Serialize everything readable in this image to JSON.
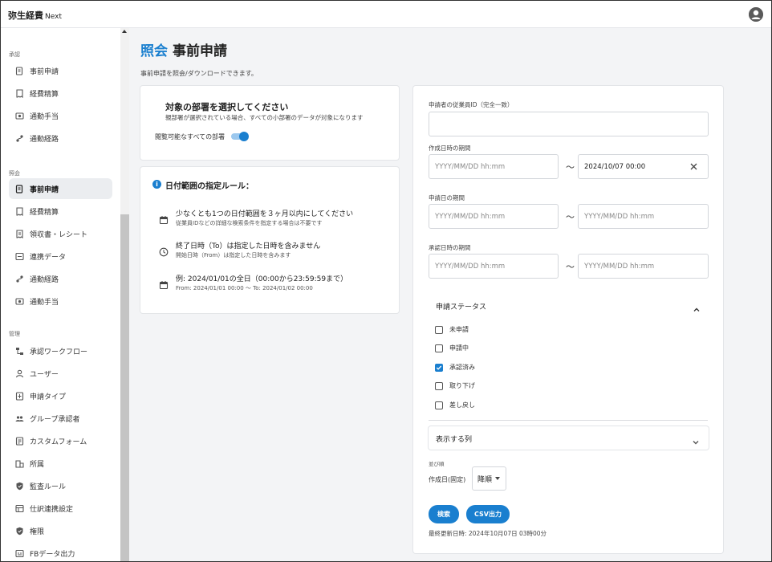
{
  "app": {
    "logo": "弥生経費",
    "logo_suffix": "Next"
  },
  "sidebar": {
    "sections": [
      {
        "label": "承認"
      },
      {
        "label": "照会"
      },
      {
        "label": "管理"
      }
    ],
    "approval_items": [
      {
        "label": "事前申請",
        "icon": "document-icon"
      },
      {
        "label": "経費精算",
        "icon": "receipt-icon"
      },
      {
        "label": "通勤手当",
        "icon": "commute-allowance-icon"
      },
      {
        "label": "通勤経路",
        "icon": "route-icon"
      }
    ],
    "inquiry_items": [
      {
        "label": "事前申請",
        "icon": "document-icon",
        "active": true
      },
      {
        "label": "経費精算",
        "icon": "receipt-icon"
      },
      {
        "label": "領収書・レシート",
        "icon": "receipt-icon"
      },
      {
        "label": "連携データ",
        "icon": "link-data-icon"
      },
      {
        "label": "通勤経路",
        "icon": "route-icon"
      },
      {
        "label": "通勤手当",
        "icon": "commute-allowance-icon"
      }
    ],
    "admin_items": [
      {
        "label": "承認ワークフロー",
        "icon": "workflow-icon"
      },
      {
        "label": "ユーザー",
        "icon": "user-icon"
      },
      {
        "label": "申請タイプ",
        "icon": "form-type-icon"
      },
      {
        "label": "グループ承認者",
        "icon": "group-icon"
      },
      {
        "label": "カスタムフォーム",
        "icon": "custom-form-icon"
      },
      {
        "label": "所属",
        "icon": "building-icon"
      },
      {
        "label": "監査ルール",
        "icon": "shield-icon"
      },
      {
        "label": "仕訳連携設定",
        "icon": "journal-link-icon"
      },
      {
        "label": "権限",
        "icon": "shield-icon"
      },
      {
        "label": "FBデータ出力",
        "icon": "fb-export-icon"
      }
    ]
  },
  "page": {
    "crumb": "照会",
    "title": "事前申請",
    "description": "事前申請を照会/ダウンロードできます。"
  },
  "department": {
    "title": "対象の部署を選択してください",
    "subtitle": "親部署が選択されている場合、すべての小部署のデータが対象になります",
    "toggle_label": "閲覧可能なすべての部署",
    "toggle_on": true
  },
  "rules": {
    "title": "日付範囲の指定ルール：",
    "items": [
      {
        "icon": "calendar-icon",
        "main": "少なくとも1つの日付範囲を３ヶ月以内にしてください",
        "sub": "従業員IDなどの詳細な検索条件を指定する場合は不要です"
      },
      {
        "icon": "clock-icon",
        "main": "終了日時（To）は指定した日時を含みません",
        "sub": "開始日時（From）は指定した日時を含みます"
      },
      {
        "icon": "calendar-icon",
        "main": "例: 2024/01/01の全日（00:00から23:59:59まで）",
        "sub": "From: 2024/01/01 00:00 〜 To: 2024/01/02 00:00"
      }
    ]
  },
  "search": {
    "employee_id_label": "申請者の従業員ID（完全一致）",
    "employee_id_value": "",
    "created_label": "作成日時の期間",
    "created_from_placeholder": "YYYY/MM/DD hh:mm",
    "created_to_value": "2024/10/07 00:00",
    "applied_label": "申請日の期間",
    "applied_from_placeholder": "YYYY/MM/DD hh:mm",
    "applied_to_placeholder": "YYYY/MM/DD hh:mm",
    "approved_label": "承認日時の期間",
    "approved_from_placeholder": "YYYY/MM/DD hh:mm",
    "approved_to_placeholder": "YYYY/MM/DD hh:mm",
    "tilde": "〜",
    "status_header": "申請ステータス",
    "statuses": [
      {
        "label": "未申請",
        "checked": false
      },
      {
        "label": "申請中",
        "checked": false
      },
      {
        "label": "承認済み",
        "checked": true
      },
      {
        "label": "取り下げ",
        "checked": false
      },
      {
        "label": "差し戻し",
        "checked": false
      }
    ],
    "columns_label": "表示する列",
    "sort_section": "並び順",
    "sort_field": "作成日(固定)",
    "sort_order": "降順",
    "search_button": "検索",
    "csv_button": "CSV出力",
    "last_updated": "最終更新日時: 2024年10月07日 03時00分"
  },
  "colors": {
    "accent": "#1a7fcf",
    "active_bg": "#ebedf0",
    "main_bg": "#f3f4f6"
  }
}
